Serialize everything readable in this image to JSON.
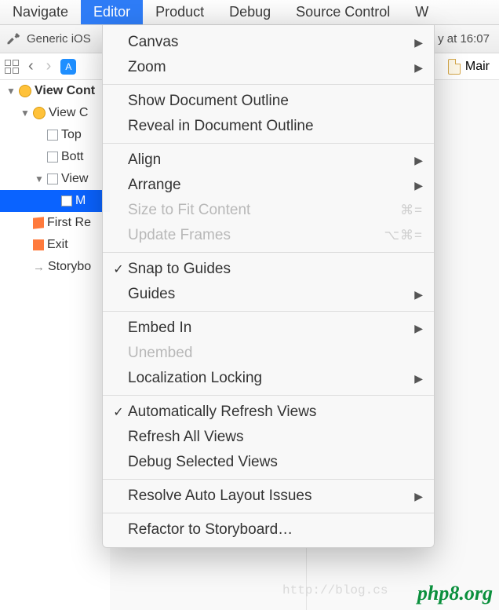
{
  "menubar": {
    "items": [
      "Navigate",
      "Editor",
      "Product",
      "Debug",
      "Source Control",
      "W"
    ],
    "active_index": 1
  },
  "toolbar": {
    "scheme": "Generic iOS",
    "status_right": "y at 16:07"
  },
  "navbar": {
    "doc_label": "Mair"
  },
  "outline": {
    "rows": [
      {
        "indent": 0,
        "disc": true,
        "icon": "scene",
        "label": "View Cont",
        "bold": true
      },
      {
        "indent": 1,
        "disc": true,
        "icon": "scene",
        "label": "View C"
      },
      {
        "indent": 2,
        "disc": false,
        "icon": "view",
        "label": "Top"
      },
      {
        "indent": 2,
        "disc": false,
        "icon": "view",
        "label": "Bott"
      },
      {
        "indent": 2,
        "disc": true,
        "icon": "view",
        "label": "View"
      },
      {
        "indent": 3,
        "disc": false,
        "icon": "view",
        "label": "M",
        "selected": true
      },
      {
        "indent": 1,
        "disc": false,
        "icon": "cube",
        "label": "First Re"
      },
      {
        "indent": 1,
        "disc": false,
        "icon": "exit",
        "label": "Exit"
      },
      {
        "indent": 1,
        "disc": false,
        "icon": "arrow",
        "label": "Storybo"
      }
    ]
  },
  "menu": {
    "groups": [
      [
        {
          "label": "Canvas",
          "submenu": true
        },
        {
          "label": "Zoom",
          "submenu": true
        }
      ],
      [
        {
          "label": "Show Document Outline"
        },
        {
          "label": "Reveal in Document Outline"
        }
      ],
      [
        {
          "label": "Align",
          "submenu": true
        },
        {
          "label": "Arrange",
          "submenu": true
        },
        {
          "label": "Size to Fit Content",
          "disabled": true,
          "shortcut": "⌘="
        },
        {
          "label": "Update Frames",
          "disabled": true,
          "shortcut": "⌥⌘="
        }
      ],
      [
        {
          "label": "Snap to Guides",
          "checked": true
        },
        {
          "label": "Guides",
          "submenu": true
        }
      ],
      [
        {
          "label": "Embed In",
          "submenu": true
        },
        {
          "label": "Unembed",
          "disabled": true
        },
        {
          "label": "Localization Locking",
          "submenu": true
        }
      ],
      [
        {
          "label": "Automatically Refresh Views",
          "checked": true
        },
        {
          "label": "Refresh All Views"
        },
        {
          "label": "Debug Selected Views"
        }
      ],
      [
        {
          "label": "Resolve Auto Layout Issues",
          "submenu": true
        }
      ],
      [
        {
          "label": "Refactor to Storyboard…"
        }
      ]
    ]
  },
  "watermarks": {
    "blog": "http://blog.cs",
    "site": "php8.org"
  }
}
